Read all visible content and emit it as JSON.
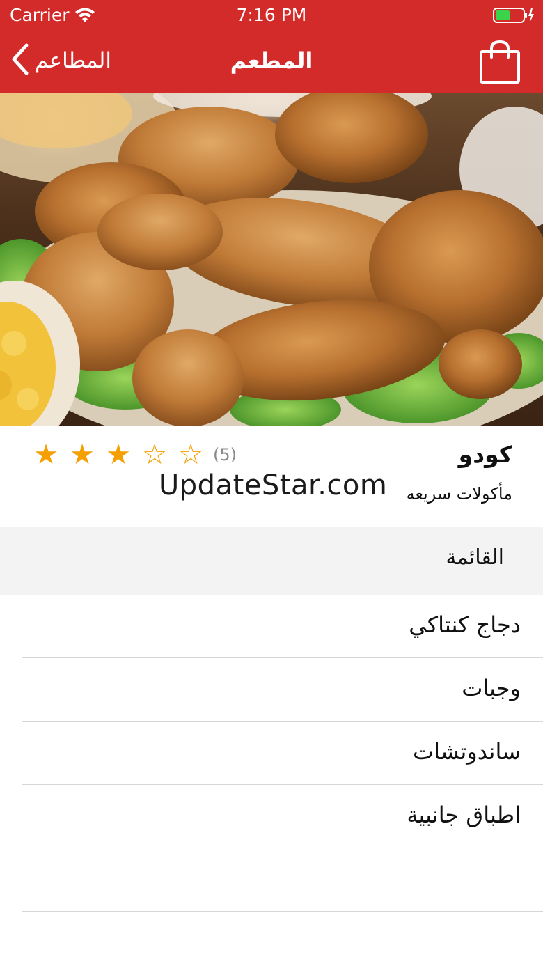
{
  "status_bar": {
    "carrier": "Carrier",
    "time": "7:16 PM"
  },
  "nav": {
    "back_label": "المطاعم",
    "title": "المطعم",
    "cart_icon": "shopping-bag-icon"
  },
  "hero": {
    "icon": "fried-chicken-photo"
  },
  "restaurant": {
    "name": "كودو",
    "category": "مأكولات سريعه",
    "rating": 3,
    "rating_max": 5,
    "review_count": "(5)"
  },
  "watermark": "UpdateStar.com",
  "menu": {
    "header": "القائمة",
    "items": [
      {
        "label": "دجاج كنتاكي"
      },
      {
        "label": "وجبات"
      },
      {
        "label": "ساندوتشات"
      },
      {
        "label": "اطباق جانبية"
      },
      {
        "label": ""
      }
    ]
  },
  "colors": {
    "header": "#d32a2a",
    "star": "#f5a000",
    "menu_header_bg": "#f3f3f3"
  }
}
